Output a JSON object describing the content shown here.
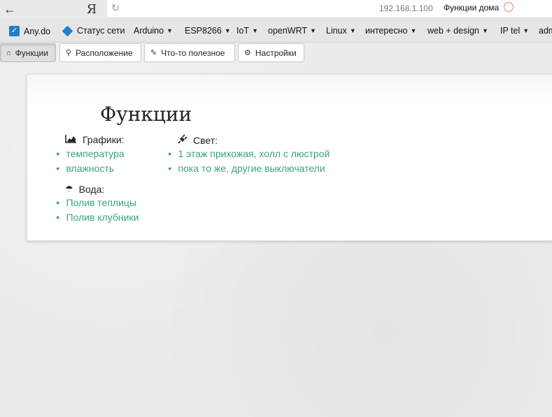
{
  "browser": {
    "back_glyph": "←",
    "yandex_glyph": "Я",
    "reload_glyph": "↻",
    "url": "192.168.1.100",
    "tab_title": "Функции дома"
  },
  "bookmarks": [
    {
      "label": "Any.do"
    },
    {
      "label": "Статус сети"
    },
    {
      "label": "Arduino",
      "dropdown": true
    },
    {
      "label": "ESP8266",
      "dropdown": true
    },
    {
      "label": "IoT",
      "dropdown": true
    },
    {
      "label": "openWRT",
      "dropdown": true
    },
    {
      "label": "Linux",
      "dropdown": true
    },
    {
      "label": "интересно",
      "dropdown": true
    },
    {
      "label": "web + design",
      "dropdown": true
    },
    {
      "label": "IP tel",
      "dropdown": true
    },
    {
      "label": "adm"
    }
  ],
  "caret_glyph": "▼",
  "nav": {
    "tabs": [
      {
        "label": "Функции",
        "icon": "home-icon",
        "active": true
      },
      {
        "label": "Расположение",
        "icon": "map-marker-icon"
      },
      {
        "label": "Что-то полезное",
        "icon": "pencil-icon"
      },
      {
        "label": "Настройки",
        "icon": "cog-icon"
      }
    ]
  },
  "main": {
    "title": "Функции",
    "sections": {
      "charts": {
        "label": "Графики:",
        "icon": "area-chart-icon",
        "links": [
          "температура",
          "влажность"
        ]
      },
      "light": {
        "label": "Свет:",
        "icon": "plug-icon",
        "links": [
          "1 этаж прихожая, холл с люстрой",
          "пока то же, другие выключатели"
        ]
      },
      "water": {
        "label": "Вода:",
        "icon": "umbrella-icon",
        "links": [
          "Полив теплицы",
          "Полив клубники"
        ]
      }
    }
  }
}
